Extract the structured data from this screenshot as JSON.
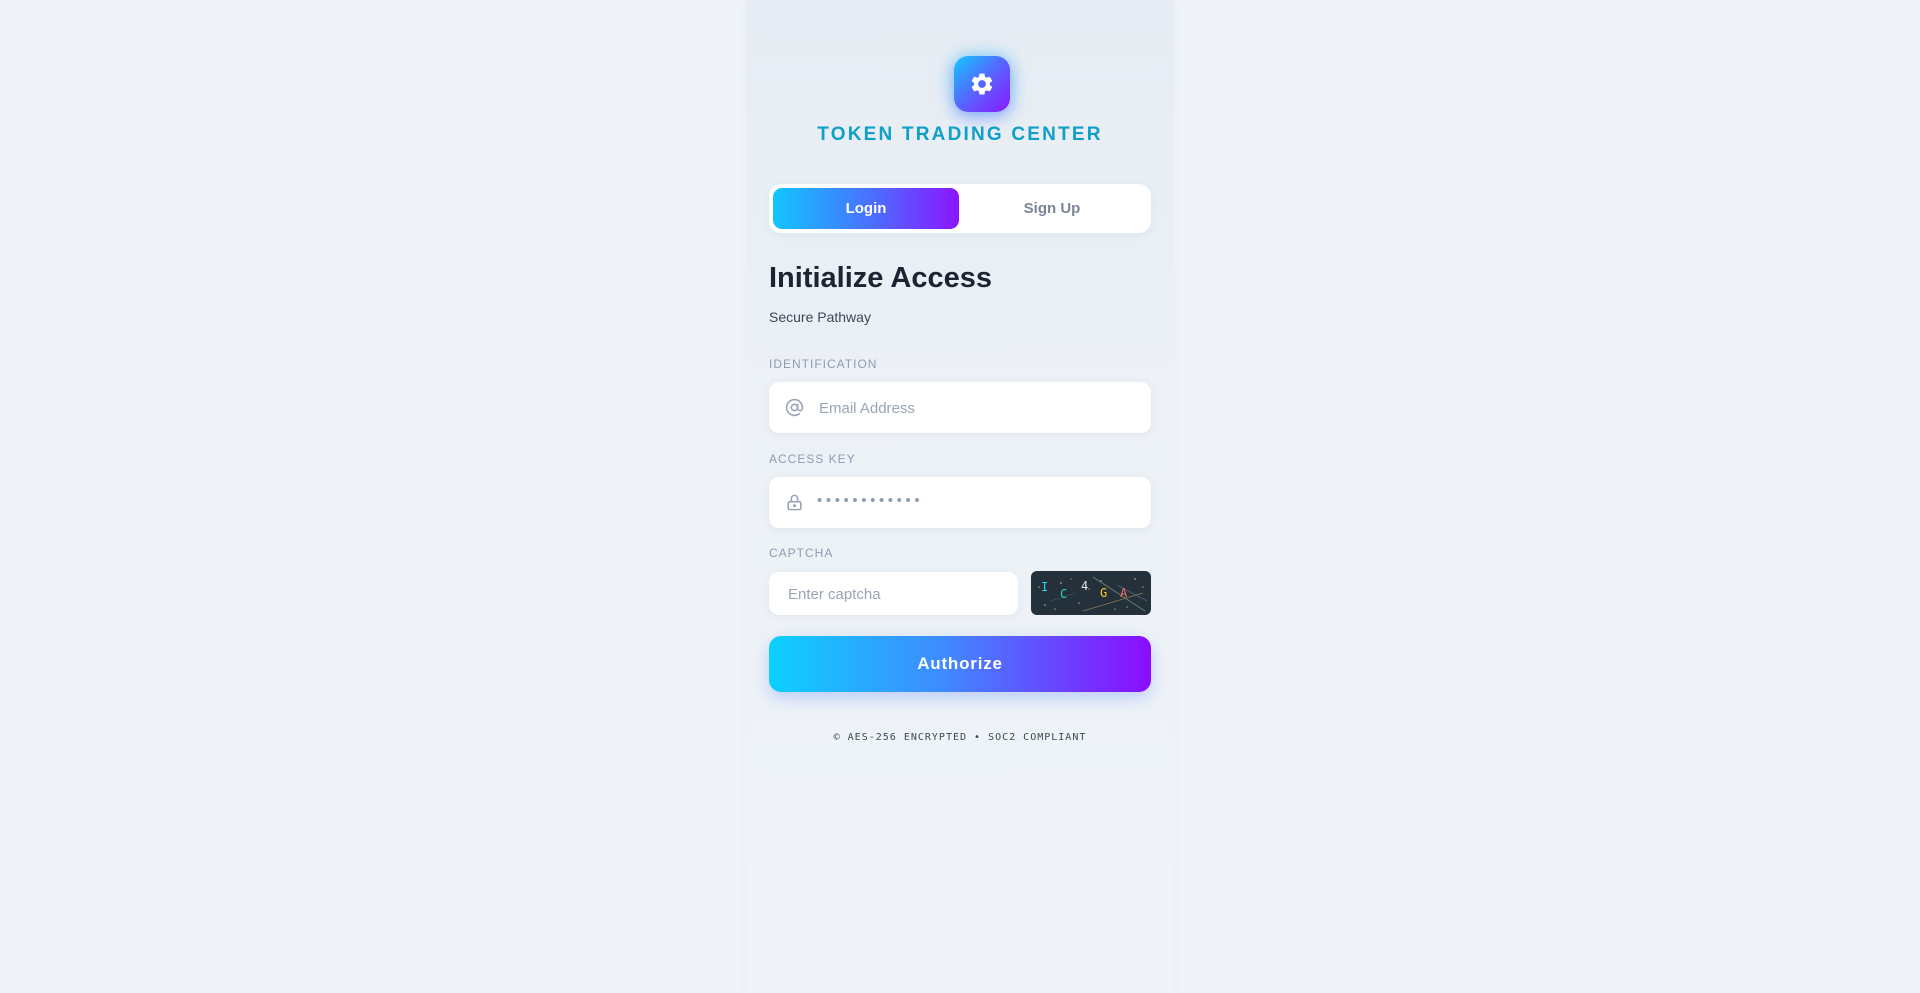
{
  "brand": {
    "title": "TOKEN TRADING CENTER",
    "logo_icon": "gear-icon"
  },
  "auth_tabs": {
    "login_label": "Login",
    "signup_label": "Sign Up",
    "active": "Login"
  },
  "form": {
    "heading": "Initialize Access",
    "subheading": "Secure Pathway",
    "email": {
      "label": "IDENTIFICATION",
      "placeholder": "Email Address",
      "icon": "at-sign-icon"
    },
    "password": {
      "label": "ACCESS KEY",
      "value_masked": "••••••••••••",
      "icon": "lock-icon"
    },
    "captcha": {
      "label": "CAPTCHA",
      "placeholder": "Enter captcha",
      "image_chars": [
        "I",
        "C",
        "4",
        "G",
        "A"
      ],
      "image_char_colors": [
        "#22d3ee",
        "#2dd4bf",
        "#e5e7eb",
        "#facc15",
        "#f87171"
      ]
    },
    "submit_label": "Authorize"
  },
  "footer": {
    "text": "© AES-256 ENCRYPTED • SOC2 COMPLIANT"
  },
  "colors": {
    "accent_cyan": "#12c6ff",
    "accent_purple": "#8b14ff",
    "brand_text": "#0ea0c8"
  }
}
